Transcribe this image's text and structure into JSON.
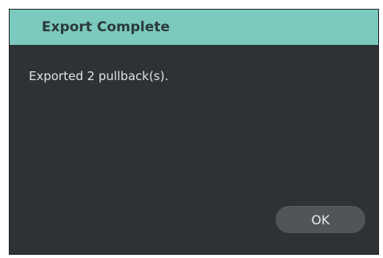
{
  "dialog": {
    "title": "Export Complete",
    "message": "Exported 2 pullback(s).",
    "ok_label": "OK"
  },
  "colors": {
    "titlebar": "#7cc9bd",
    "background": "#2f3234",
    "button": "#505557"
  }
}
